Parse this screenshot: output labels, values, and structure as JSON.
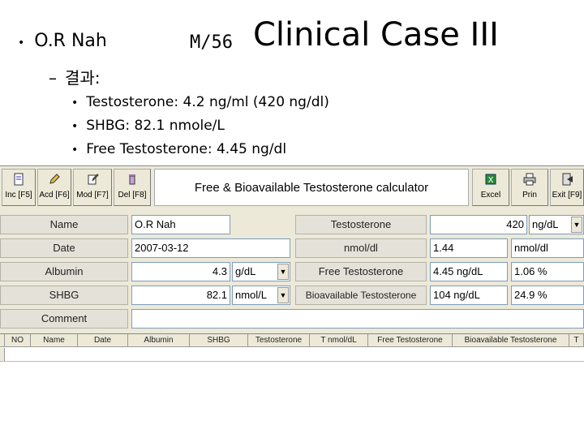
{
  "slide": {
    "title": "Clinical Case III",
    "patient_name": "O.R Nah",
    "patient_age": "M/56",
    "sub_bullet": "결과:",
    "results": [
      "Testosterone: 4.2 ng/ml (420 ng/dl)",
      "SHBG: 82.1 nmole/L",
      "Free Testosterone: 4.45 ng/dl"
    ]
  },
  "app": {
    "title": "Free & Bioavailable Testosterone calculator",
    "toolbar_left": [
      {
        "label": "Inc [F5]",
        "icon": "document-icon"
      },
      {
        "label": "Acd [F6]",
        "icon": "pencil-icon"
      },
      {
        "label": "Mod [F7]",
        "icon": "edit-icon"
      },
      {
        "label": "Del [F8]",
        "icon": "trash-icon"
      }
    ],
    "toolbar_right": [
      {
        "label": "Excel",
        "icon": "excel-icon"
      },
      {
        "label": "Prin",
        "icon": "printer-icon"
      },
      {
        "label": "Exit [F9]",
        "icon": "exit-icon"
      }
    ],
    "form": {
      "name_label": "Name",
      "name_value": "O.R Nah",
      "date_label": "Date",
      "date_value": "2007-03-12",
      "albumin_label": "Albumin",
      "albumin_value": "4.3",
      "albumin_unit": "g/dL",
      "shbg_label": "SHBG",
      "shbg_value": "82.1",
      "shbg_unit": "nmol/L",
      "comment_label": "Comment",
      "comment_value": "",
      "testosterone_label": "Testosterone",
      "testosterone_value": "420",
      "testosterone_unit": "ng/dL",
      "nmol_label": "nmol/dl",
      "nmol_value": "1.44",
      "nmol_unit": "nmol/dl",
      "free_t_label": "Free Testosterone",
      "free_t_value": "4.45 ng/dL",
      "free_t_pct": "1.06 %",
      "bio_t_label": "Bioavailable Testosterone",
      "bio_t_value": "104 ng/dL",
      "bio_t_pct": "24.9 %"
    },
    "grid_headers": [
      "NO",
      "Name",
      "Date",
      "Albumin",
      "SHBG",
      "Testosterone",
      "T nmol/dL",
      "Free Testosterone",
      "Bioavailable Testosterone",
      "T"
    ]
  }
}
